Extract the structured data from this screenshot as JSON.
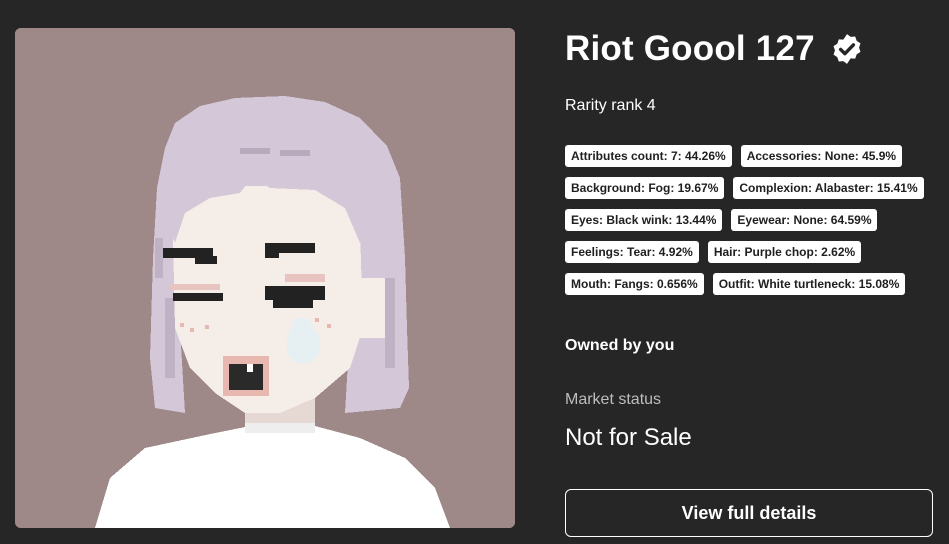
{
  "nft": {
    "title": "Riot Goool 127",
    "verified_icon": "verified-badge-icon",
    "rarity": "Rarity rank 4",
    "attributes": [
      "Attributes count: 7: 44.26%",
      "Accessories: None: 45.9%",
      "Background: Fog: 19.67%",
      "Complexion: Alabaster: 15.41%",
      "Eyes: Black wink: 13.44%",
      "Eyewear: None: 64.59%",
      "Feelings: Tear: 4.92%",
      "Hair: Purple chop: 2.62%",
      "Mouth: Fangs: 0.656%",
      "Outfit: White turtleneck: 15.08%"
    ],
    "ownership": "Owned by you",
    "market_label": "Market status",
    "market_status": "Not for Sale",
    "details_button": "View full details"
  },
  "colors": {
    "page_bg": "#262626",
    "art_bg": "#9e8888",
    "hair": "#d4c8d8",
    "skin": "#f4ede8",
    "outfit": "#ffffff",
    "chip_bg": "#ffffff"
  }
}
